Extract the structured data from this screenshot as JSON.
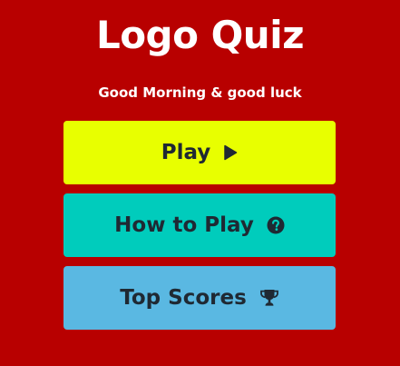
{
  "title": "Logo Quiz",
  "greeting": "Good Morning & good luck",
  "menu": {
    "play_label": "Play",
    "how_to_play_label": "How to Play",
    "top_scores_label": "Top Scores"
  },
  "icons": {
    "play": "play-triangle-icon",
    "how_to_play": "question-circle-icon",
    "top_scores": "trophy-icon"
  },
  "colors": {
    "background": "#b80000",
    "play_button": "#e8ff00",
    "how_to_play_button": "#00ccbc",
    "top_scores_button": "#5ab8e2",
    "button_text": "#1f2933",
    "title_text": "#ffffff"
  }
}
